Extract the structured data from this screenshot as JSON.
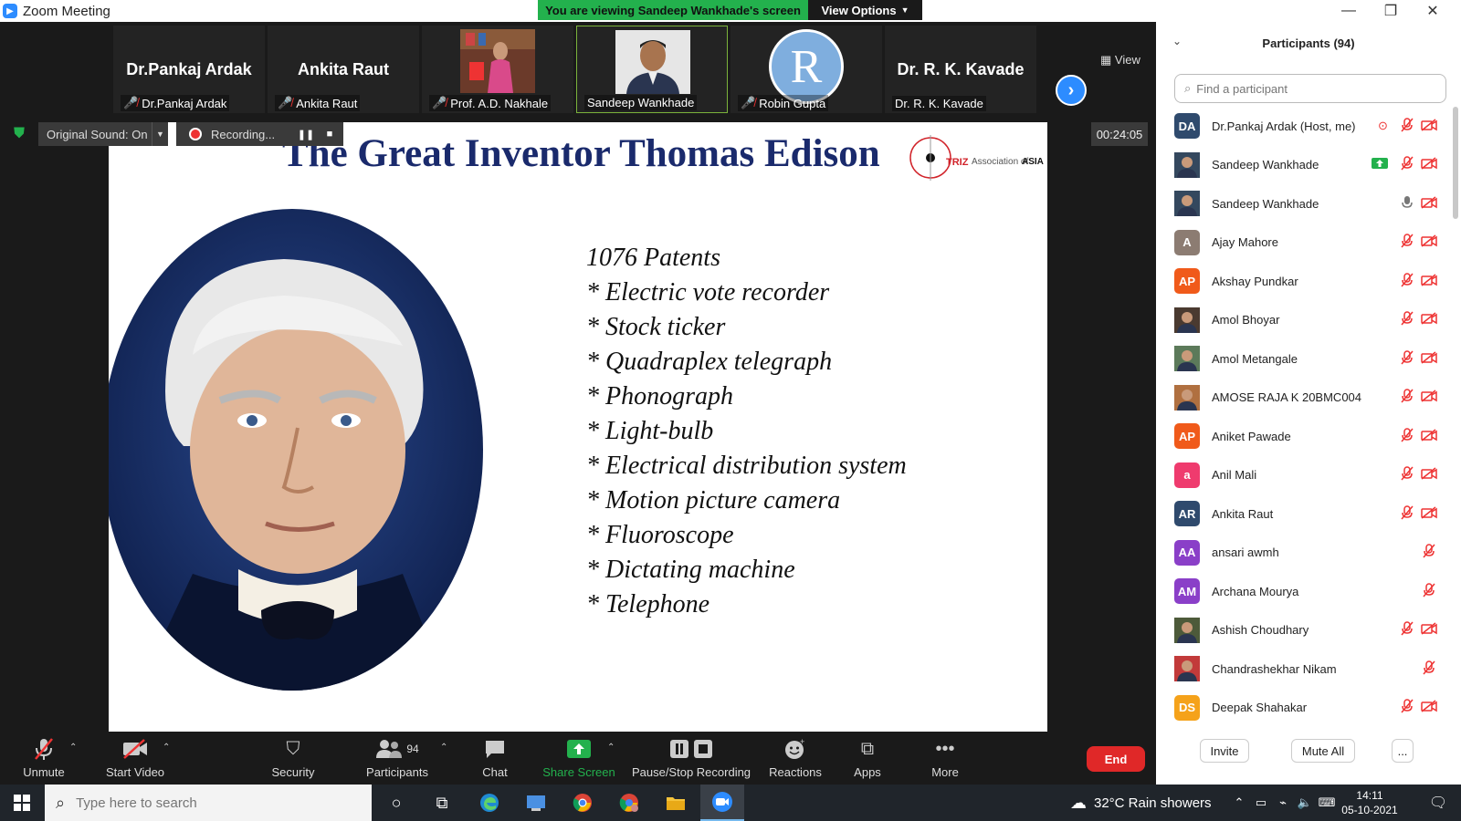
{
  "window": {
    "title": "Zoom Meeting"
  },
  "banner": {
    "viewing": "You are viewing Sandeep Wankhade's screen",
    "view_options": "View Options"
  },
  "thumbs": [
    {
      "big": "Dr.Pankaj Ardak",
      "label": "Dr.Pankaj Ardak",
      "muted": true
    },
    {
      "big": "Ankita Raut",
      "label": "Ankita Raut",
      "muted": true
    },
    {
      "big": "",
      "label": "Prof. A.D. Nakhale",
      "muted": true
    },
    {
      "big": "",
      "label": "Sandeep Wankhade",
      "muted": false
    },
    {
      "big": "R",
      "label": "Robin Gupta",
      "muted": true
    },
    {
      "big": "Dr. R. K. Kavade",
      "label": "Dr. R. K. Kavade",
      "muted": false
    }
  ],
  "view_btn": "View",
  "controls": {
    "original_sound": "Original Sound: On",
    "recording": "Recording...",
    "timer": "00:24:05"
  },
  "slide": {
    "title": "The Great Inventor Thomas Edison",
    "logo": {
      "triz": "TRIZ",
      "assoc": "Association of",
      "asia": "ASIA"
    },
    "facts": [
      "1076 Patents",
      "* Electric vote recorder",
      "* Stock ticker",
      "* Quadraplex telegraph",
      "* Phonograph",
      "* Light-bulb",
      "* Electrical distribution system",
      "* Motion picture camera",
      "* Fluoroscope",
      "* Dictating machine",
      "* Telephone"
    ]
  },
  "toolbar": {
    "unmute": "Unmute",
    "start_video": "Start Video",
    "security": "Security",
    "participants": "Participants",
    "participants_count": "94",
    "chat": "Chat",
    "share_screen": "Share Screen",
    "pause_stop": "Pause/Stop Recording",
    "reactions": "Reactions",
    "apps": "Apps",
    "more": "More",
    "end": "End"
  },
  "panel": {
    "title": "Participants (94)",
    "search_placeholder": "Find a participant",
    "participants": [
      {
        "initials": "DA",
        "name": "Dr.Pankaj Ardak (Host, me)",
        "color": "#2f4a6d",
        "photo": false
      },
      {
        "initials": "",
        "name": "Sandeep Wankhade",
        "color": "#34485e",
        "photo": true
      },
      {
        "initials": "",
        "name": "Sandeep Wankhade",
        "color": "#34485e",
        "photo": true
      },
      {
        "initials": "A",
        "name": "Ajay Mahore",
        "color": "#8c7c72",
        "photo": false
      },
      {
        "initials": "AP",
        "name": "Akshay Pundkar",
        "color": "#f05a1a",
        "photo": false
      },
      {
        "initials": "",
        "name": "Amol Bhoyar",
        "color": "#4a3a30",
        "photo": true
      },
      {
        "initials": "",
        "name": "Amol Metangale",
        "color": "#5c7a5a",
        "photo": true
      },
      {
        "initials": "",
        "name": "AMOSE RAJA K 20BMC004",
        "color": "#b07040",
        "photo": true
      },
      {
        "initials": "AP",
        "name": "Aniket Pawade",
        "color": "#f05a1a",
        "photo": false
      },
      {
        "initials": "a",
        "name": "Anil Mali",
        "color": "#ef3b6e",
        "photo": false
      },
      {
        "initials": "AR",
        "name": "Ankita Raut",
        "color": "#2f4a6d",
        "photo": false
      },
      {
        "initials": "AA",
        "name": "ansari awmh",
        "color": "#8a3fc8",
        "photo": false
      },
      {
        "initials": "AM",
        "name": "Archana Mourya",
        "color": "#8a3fc8",
        "photo": false
      },
      {
        "initials": "",
        "name": "Ashish Choudhary",
        "color": "#4d5a3a",
        "photo": true
      },
      {
        "initials": "",
        "name": "Chandrashekhar Nikam",
        "color": "#c23a3a",
        "photo": true
      },
      {
        "initials": "DS",
        "name": "Deepak Shahakar",
        "color": "#f5a21a",
        "photo": false
      }
    ],
    "invite": "Invite",
    "mute_all": "Mute All",
    "more": "..."
  },
  "taskbar": {
    "search_placeholder": "Type here to search",
    "weather": "32°C  Rain showers",
    "time": "14:11",
    "date": "05-10-2021"
  }
}
